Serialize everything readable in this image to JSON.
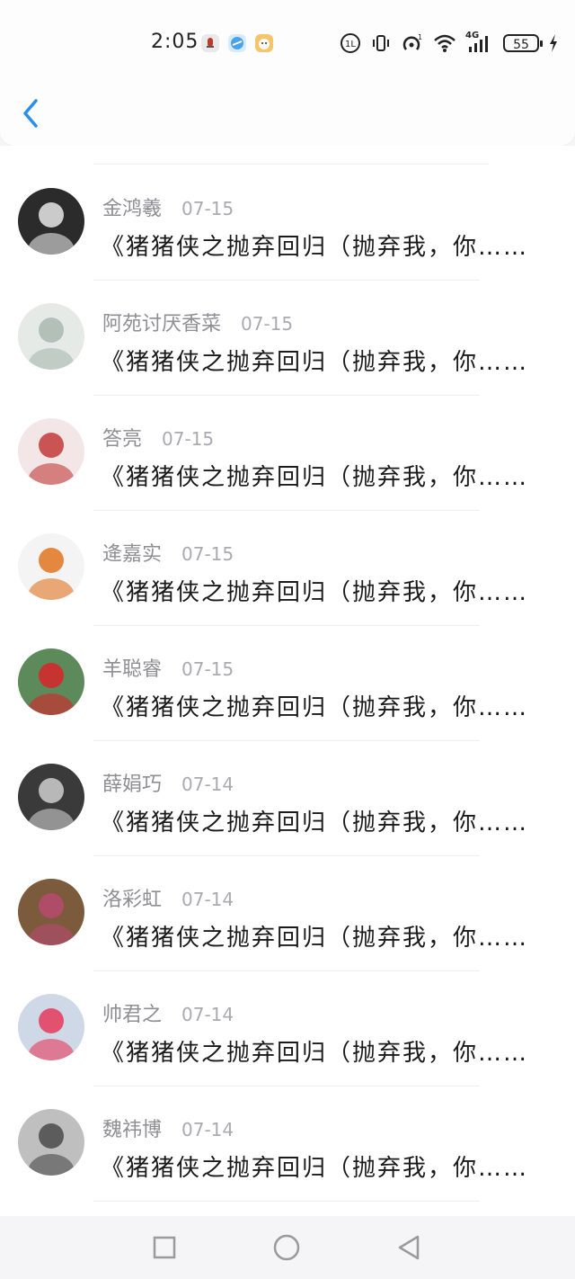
{
  "status_bar": {
    "time": "2:05",
    "battery_level": "55",
    "network_label": "4G",
    "hotspot_count": "1"
  },
  "header": {
    "back_icon": "chevron-left-icon",
    "accent_color": "#2a8fe6"
  },
  "comments": [
    {
      "name": "金鸿羲",
      "date": "07-15",
      "message": "《猪猪侠之抛弃回归（抛弃我，你……",
      "avatar": {
        "bg": "#2b2b2b",
        "fg": "#e8e8e8",
        "motif": "dark-haired anime character"
      }
    },
    {
      "name": "阿苑讨厌香菜",
      "date": "07-15",
      "message": "《猪猪侠之抛弃回归（抛弃我，你……",
      "avatar": {
        "bg": "#e6eae6",
        "fg": "#a9b9ae",
        "motif": "pale anime girl"
      }
    },
    {
      "name": "答亮",
      "date": "07-15",
      "message": "《猪猪侠之抛弃回归（抛弃我，你……",
      "avatar": {
        "bg": "#f3e6e6",
        "fg": "#c23a3a",
        "motif": "anime girl in red"
      }
    },
    {
      "name": "逄嘉实",
      "date": "07-15",
      "message": "《猪猪侠之抛弃回归（抛弃我，你……",
      "avatar": {
        "bg": "#f4f4f4",
        "fg": "#e0731f",
        "motif": "orange sports car"
      }
    },
    {
      "name": "羊聪睿",
      "date": "07-15",
      "message": "《猪猪侠之抛弃回归（抛弃我，你……",
      "avatar": {
        "bg": "#5d8a5a",
        "fg": "#d9232a",
        "motif": "red toy among plants"
      }
    },
    {
      "name": "薛娟巧",
      "date": "07-14",
      "message": "《猪猪侠之抛弃回归（抛弃我，你……",
      "avatar": {
        "bg": "#3a3a3a",
        "fg": "#cfcfcf",
        "motif": "car seat interior"
      }
    },
    {
      "name": "洛彩虹",
      "date": "07-14",
      "message": "《猪猪侠之抛弃回归（抛弃我，你……",
      "avatar": {
        "bg": "#7c5a3c",
        "fg": "#b94a6e",
        "motif": "pink flower sculpture"
      }
    },
    {
      "name": "帅君之",
      "date": "07-14",
      "message": "《猪猪侠之抛弃回归（抛弃我，你……",
      "avatar": {
        "bg": "#cfd8e6",
        "fg": "#e63a5a",
        "motif": "costumed character"
      }
    },
    {
      "name": "魏祎博",
      "date": "07-14",
      "message": "《猪猪侠之抛弃回归（抛弃我，你……",
      "avatar": {
        "bg": "#bfbfbf",
        "fg": "#4a4a4a",
        "motif": "group photo"
      }
    }
  ],
  "nav": {
    "recent_icon": "square-icon",
    "home_icon": "circle-icon",
    "back_icon": "triangle-back-icon"
  }
}
